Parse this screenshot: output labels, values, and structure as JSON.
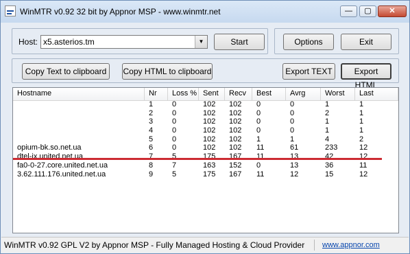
{
  "window": {
    "title": "WinMTR v0.92 32 bit by Appnor MSP - www.winmtr.net"
  },
  "titlebar_buttons": {
    "minimize": "—",
    "maximize": "▢",
    "close": "✕"
  },
  "host": {
    "label": "Host:",
    "value": "x5.asterios.tm"
  },
  "buttons": {
    "start": "Start",
    "options": "Options",
    "exit": "Exit",
    "copy_text": "Copy Text to clipboard",
    "copy_html": "Copy HTML to clipboard",
    "export_text": "Export TEXT",
    "export_html": "Export HTML"
  },
  "table": {
    "columns": [
      "Hostname",
      "Nr",
      "Loss %",
      "Sent",
      "Recv",
      "Best",
      "Avrg",
      "Worst",
      "Last"
    ],
    "rows": [
      [
        "",
        "1",
        "0",
        "102",
        "102",
        "0",
        "0",
        "1",
        "1"
      ],
      [
        "",
        "2",
        "0",
        "102",
        "102",
        "0",
        "0",
        "2",
        "1"
      ],
      [
        "",
        "3",
        "0",
        "102",
        "102",
        "0",
        "0",
        "1",
        "1"
      ],
      [
        "",
        "4",
        "0",
        "102",
        "102",
        "0",
        "0",
        "1",
        "1"
      ],
      [
        "",
        "5",
        "0",
        "102",
        "102",
        "1",
        "1",
        "4",
        "2"
      ],
      [
        "opium-bk.so.net.ua",
        "6",
        "0",
        "102",
        "102",
        "11",
        "61",
        "233",
        "12"
      ],
      [
        "dtel-ix.united.net.ua",
        "7",
        "5",
        "175",
        "167",
        "11",
        "13",
        "42",
        "12"
      ],
      [
        "fa0-0-27.core.united.net.ua",
        "8",
        "7",
        "163",
        "152",
        "0",
        "13",
        "36",
        "11"
      ],
      [
        "3.62.111.176.united.net.ua",
        "9",
        "5",
        "175",
        "167",
        "11",
        "12",
        "15",
        "12"
      ]
    ]
  },
  "status": {
    "text": "WinMTR v0.92 GPL V2 by Appnor MSP - Fully Managed Hosting & Cloud Provider",
    "link": "www.appnor.com"
  }
}
